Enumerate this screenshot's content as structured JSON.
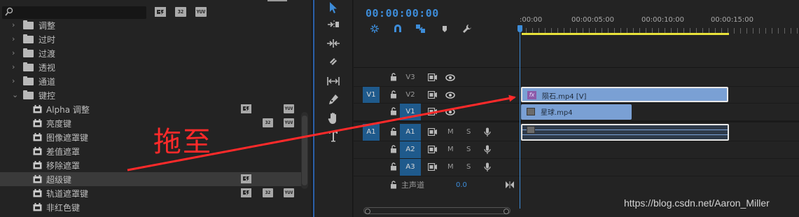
{
  "effects_panel": {
    "search": {
      "value": "",
      "placeholder": ""
    },
    "filter_badges": [
      "32",
      "YUV"
    ],
    "folders": [
      {
        "label": "调整",
        "expanded": false
      },
      {
        "label": "过时",
        "expanded": false
      },
      {
        "label": "过渡",
        "expanded": false
      },
      {
        "label": "透视",
        "expanded": false
      },
      {
        "label": "通道",
        "expanded": false
      },
      {
        "label": "键控",
        "expanded": true
      }
    ],
    "effects": [
      {
        "label": "Alpha 调整",
        "badges": [
          "accel",
          "",
          "YUV"
        ],
        "selected": false
      },
      {
        "label": "亮度键",
        "badges": [
          "",
          "32",
          "YUV"
        ],
        "selected": false
      },
      {
        "label": "图像遮罩键",
        "badges": [],
        "selected": false
      },
      {
        "label": "差值遮罩",
        "badges": [],
        "selected": false
      },
      {
        "label": "移除遮罩",
        "badges": [],
        "selected": false
      },
      {
        "label": "超级键",
        "badges": [
          "accel"
        ],
        "selected": true
      },
      {
        "label": "轨道遮罩键",
        "badges": [
          "accel",
          "32",
          "YUV"
        ],
        "selected": false
      },
      {
        "label": "非红色键",
        "badges": [],
        "selected": false
      }
    ]
  },
  "tools": [
    "selection-tool",
    "track-select-tool",
    "ripple-edit-tool",
    "razor-tool",
    "slip-tool",
    "pen-tool",
    "hand-tool",
    "type-tool"
  ],
  "timeline": {
    "timecode": "00:00:00:00",
    "ruler_labels": [
      ":00:00",
      "00:00:05:00",
      "00:00:10:00",
      "00:00:15:00"
    ],
    "video_tracks": [
      {
        "name": "V3",
        "source_target": "",
        "active": false,
        "clips": []
      },
      {
        "name": "V2",
        "source_target": "V1",
        "active": false,
        "clips": [
          {
            "label": "陨石.mp4 [V]",
            "fx": "fx",
            "color": "#7aa0d4"
          }
        ]
      },
      {
        "name": "V1",
        "source_target": "",
        "active": true,
        "clips": [
          {
            "label": "星球.mp4",
            "color": "#7aa0d4"
          }
        ]
      }
    ],
    "audio_tracks": [
      {
        "name": "A1",
        "source_target": "A1",
        "active": true,
        "m": "M",
        "s": "S"
      },
      {
        "name": "A2",
        "source_target": "",
        "active": true,
        "m": "M",
        "s": "S"
      },
      {
        "name": "A3",
        "source_target": "",
        "active": true,
        "m": "M",
        "s": "S"
      }
    ],
    "master": {
      "label": "主声道",
      "value": "0.0"
    }
  },
  "annotation": {
    "text": "拖至",
    "color": "#ff2a2a"
  },
  "watermark": "https://blog.csdn.net/Aaron_Miller",
  "colors": {
    "accent": "#3d8cd8",
    "work_area": "#e8e23a",
    "clip": "#7aa0d4",
    "target": "#1f5a8c"
  }
}
